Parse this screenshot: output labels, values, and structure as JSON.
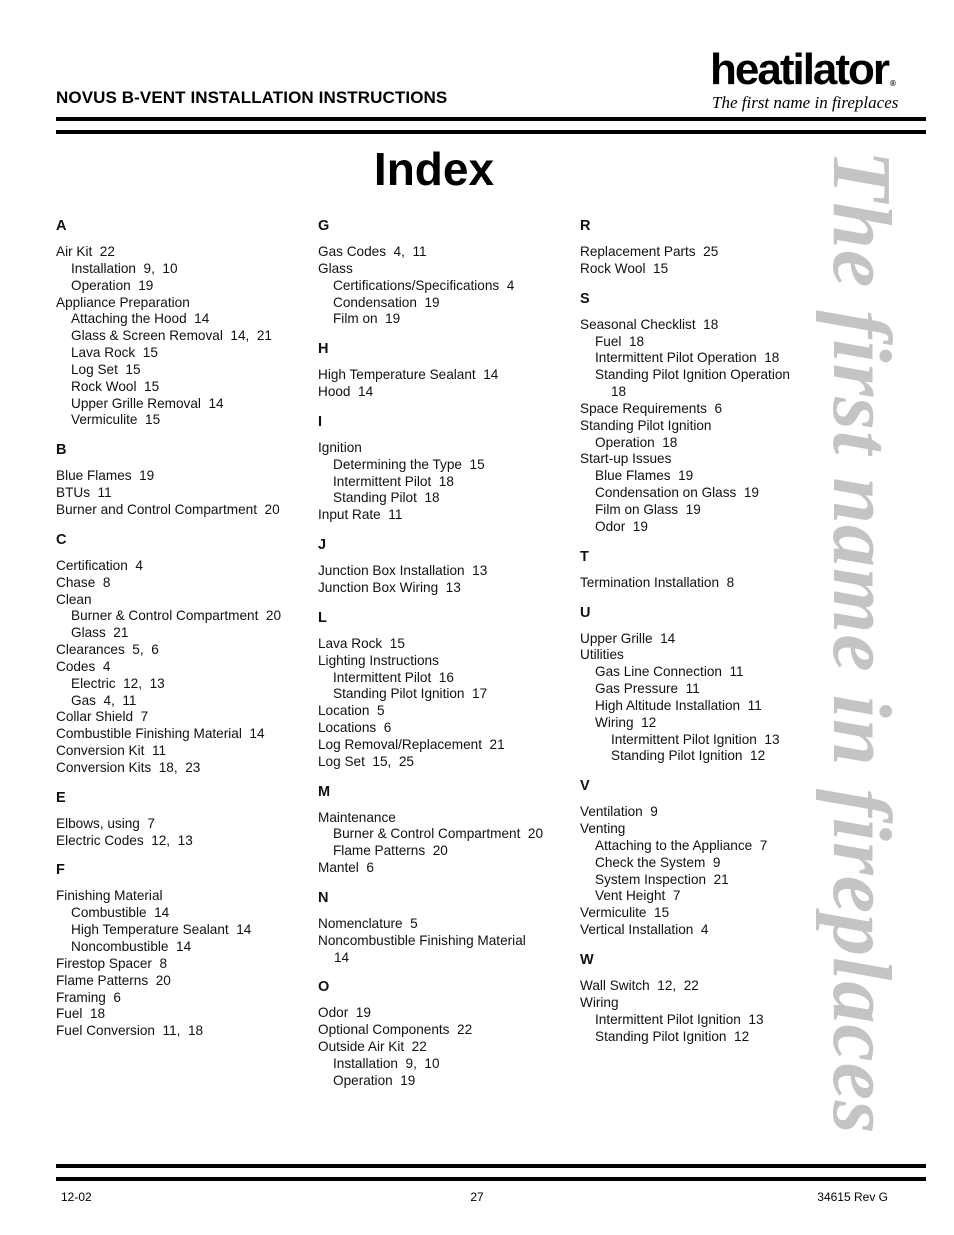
{
  "header": {
    "doc_title": "NOVUS B-VENT INSTALLATION INSTRUCTIONS",
    "logo": {
      "wordmark": "heatilator",
      "registered": "®",
      "tagline": "The first name in fireplaces"
    }
  },
  "page_title": "Index",
  "watermark": "The first name in fireplaces",
  "columns": [
    {
      "sections": [
        {
          "letter": "A",
          "entries": [
            {
              "level": 0,
              "text": "Air Kit  22"
            },
            {
              "level": 1,
              "text": "Installation  9,  10"
            },
            {
              "level": 1,
              "text": "Operation  19"
            },
            {
              "level": 0,
              "text": "Appliance Preparation"
            },
            {
              "level": 1,
              "text": "Attaching the Hood  14"
            },
            {
              "level": 1,
              "text": "Glass & Screen Removal  14,  21"
            },
            {
              "level": 1,
              "text": "Lava Rock  15"
            },
            {
              "level": 1,
              "text": "Log Set  15"
            },
            {
              "level": 1,
              "text": "Rock Wool  15"
            },
            {
              "level": 1,
              "text": "Upper Grille Removal  14"
            },
            {
              "level": 1,
              "text": "Vermiculite  15"
            }
          ]
        },
        {
          "letter": "B",
          "entries": [
            {
              "level": 0,
              "text": "Blue Flames  19"
            },
            {
              "level": 0,
              "text": "BTUs  11"
            },
            {
              "level": 0,
              "text": "Burner and Control Compartment  20"
            }
          ]
        },
        {
          "letter": "C",
          "entries": [
            {
              "level": 0,
              "text": "Certification  4"
            },
            {
              "level": 0,
              "text": "Chase  8"
            },
            {
              "level": 0,
              "text": "Clean"
            },
            {
              "level": 1,
              "text": "Burner & Control Compartment  20"
            },
            {
              "level": 1,
              "text": "Glass  21"
            },
            {
              "level": 0,
              "text": "Clearances  5,  6"
            },
            {
              "level": 0,
              "text": "Codes  4"
            },
            {
              "level": 1,
              "text": "Electric  12,  13"
            },
            {
              "level": 1,
              "text": "Gas  4,  11"
            },
            {
              "level": 0,
              "text": "Collar Shield  7"
            },
            {
              "level": 0,
              "text": "Combustible Finishing Material  14"
            },
            {
              "level": 0,
              "text": "Conversion Kit  11"
            },
            {
              "level": 0,
              "text": "Conversion Kits  18,  23"
            }
          ]
        },
        {
          "letter": "E",
          "entries": [
            {
              "level": 0,
              "text": "Elbows, using  7"
            },
            {
              "level": 0,
              "text": "Electric Codes  12,  13"
            }
          ]
        },
        {
          "letter": "F",
          "entries": [
            {
              "level": 0,
              "text": "Finishing Material"
            },
            {
              "level": 1,
              "text": "Combustible  14"
            },
            {
              "level": 1,
              "text": "High Temperature Sealant  14"
            },
            {
              "level": 1,
              "text": "Noncombustible  14"
            },
            {
              "level": 0,
              "text": "Firestop Spacer  8"
            },
            {
              "level": 0,
              "text": "Flame Patterns  20"
            },
            {
              "level": 0,
              "text": "Framing  6"
            },
            {
              "level": 0,
              "text": "Fuel  18"
            },
            {
              "level": 0,
              "text": "Fuel Conversion  11,  18"
            }
          ]
        }
      ]
    },
    {
      "sections": [
        {
          "letter": "G",
          "entries": [
            {
              "level": 0,
              "text": "Gas Codes  4,  11"
            },
            {
              "level": 0,
              "text": "Glass"
            },
            {
              "level": 1,
              "text": "Certifications/Specifications  4"
            },
            {
              "level": 1,
              "text": "Condensation  19"
            },
            {
              "level": 1,
              "text": "Film on  19"
            }
          ]
        },
        {
          "letter": "H",
          "entries": [
            {
              "level": 0,
              "text": "High Temperature Sealant  14"
            },
            {
              "level": 0,
              "text": "Hood  14"
            }
          ]
        },
        {
          "letter": "I",
          "entries": [
            {
              "level": 0,
              "text": "Ignition"
            },
            {
              "level": 1,
              "text": "Determining the Type  15"
            },
            {
              "level": 1,
              "text": "Intermittent Pilot  18"
            },
            {
              "level": 1,
              "text": "Standing Pilot  18"
            },
            {
              "level": 0,
              "text": "Input Rate  11"
            }
          ]
        },
        {
          "letter": "J",
          "entries": [
            {
              "level": 0,
              "text": "Junction Box Installation  13"
            },
            {
              "level": 0,
              "text": "Junction Box Wiring  13"
            }
          ]
        },
        {
          "letter": "L",
          "entries": [
            {
              "level": 0,
              "text": "Lava Rock  15"
            },
            {
              "level": 0,
              "text": "Lighting Instructions"
            },
            {
              "level": 1,
              "text": "Intermittent Pilot  16"
            },
            {
              "level": 1,
              "text": "Standing Pilot Ignition  17"
            },
            {
              "level": 0,
              "text": "Location  5"
            },
            {
              "level": 0,
              "text": "Locations  6"
            },
            {
              "level": 0,
              "text": "Log Removal/Replacement  21"
            },
            {
              "level": 0,
              "text": "Log Set  15,  25"
            }
          ]
        },
        {
          "letter": "M",
          "entries": [
            {
              "level": 0,
              "text": "Maintenance"
            },
            {
              "level": 1,
              "text": "Burner & Control Compartment  20"
            },
            {
              "level": 1,
              "text": "Flame Patterns  20"
            },
            {
              "level": 0,
              "text": "Mantel  6"
            }
          ]
        },
        {
          "letter": "N",
          "entries": [
            {
              "level": 0,
              "text": "Nomenclature  5"
            },
            {
              "level": 0,
              "text": "Noncombustible Finishing Material",
              "cont": "14"
            }
          ]
        },
        {
          "letter": "O",
          "entries": [
            {
              "level": 0,
              "text": "Odor  19"
            },
            {
              "level": 0,
              "text": "Optional Components  22"
            },
            {
              "level": 0,
              "text": "Outside Air Kit  22"
            },
            {
              "level": 1,
              "text": "Installation  9,  10"
            },
            {
              "level": 1,
              "text": "Operation  19"
            }
          ]
        }
      ]
    },
    {
      "sections": [
        {
          "letter": "R",
          "entries": [
            {
              "level": 0,
              "text": "Replacement Parts  25"
            },
            {
              "level": 0,
              "text": "Rock Wool  15"
            }
          ]
        },
        {
          "letter": "S",
          "entries": [
            {
              "level": 0,
              "text": "Seasonal Checklist  18"
            },
            {
              "level": 1,
              "text": "Fuel  18"
            },
            {
              "level": 1,
              "text": "Intermittent Pilot Operation  18"
            },
            {
              "level": 1,
              "text": "Standing Pilot Ignition Operation",
              "cont": "18"
            },
            {
              "level": 0,
              "text": "Space Requirements  6"
            },
            {
              "level": 0,
              "text": "Standing Pilot Ignition"
            },
            {
              "level": 1,
              "text": "Operation  18"
            },
            {
              "level": 0,
              "text": "Start-up Issues"
            },
            {
              "level": 1,
              "text": "Blue Flames  19"
            },
            {
              "level": 1,
              "text": "Condensation on Glass  19"
            },
            {
              "level": 1,
              "text": "Film on Glass  19"
            },
            {
              "level": 1,
              "text": "Odor  19"
            }
          ]
        },
        {
          "letter": "T",
          "entries": [
            {
              "level": 0,
              "text": "Termination Installation  8"
            }
          ]
        },
        {
          "letter": "U",
          "entries": [
            {
              "level": 0,
              "text": "Upper Grille  14"
            },
            {
              "level": 0,
              "text": "Utilities"
            },
            {
              "level": 1,
              "text": "Gas Line Connection  11"
            },
            {
              "level": 1,
              "text": "Gas Pressure  11"
            },
            {
              "level": 1,
              "text": "High Altitude Installation  11"
            },
            {
              "level": 1,
              "text": "Wiring  12"
            },
            {
              "level": 2,
              "text": "Intermittent Pilot Ignition  13"
            },
            {
              "level": 2,
              "text": "Standing Pilot Ignition  12"
            }
          ]
        },
        {
          "letter": "V",
          "entries": [
            {
              "level": 0,
              "text": "Ventilation  9"
            },
            {
              "level": 0,
              "text": "Venting"
            },
            {
              "level": 1,
              "text": "Attaching to the Appliance  7"
            },
            {
              "level": 1,
              "text": "Check the System  9"
            },
            {
              "level": 1,
              "text": "System Inspection  21"
            },
            {
              "level": 1,
              "text": "Vent Height  7"
            },
            {
              "level": 0,
              "text": "Vermiculite  15"
            },
            {
              "level": 0,
              "text": "Vertical Installation  4"
            }
          ]
        },
        {
          "letter": "W",
          "entries": [
            {
              "level": 0,
              "text": "Wall Switch  12,  22"
            },
            {
              "level": 0,
              "text": "Wiring"
            },
            {
              "level": 1,
              "text": "Intermittent Pilot Ignition  13"
            },
            {
              "level": 1,
              "text": "Standing Pilot Ignition  12"
            }
          ]
        }
      ]
    }
  ],
  "footer": {
    "date": "12-02",
    "page_number": "27",
    "doc_number": "34615 Rev G"
  }
}
